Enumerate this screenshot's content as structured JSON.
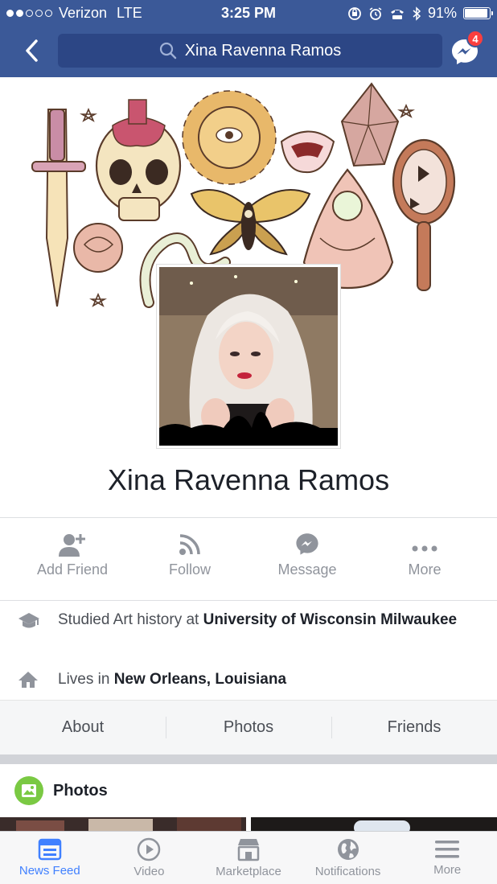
{
  "status_bar": {
    "carrier": "Verizon",
    "network": "LTE",
    "time": "3:25 PM",
    "battery": "91%"
  },
  "nav": {
    "search_text": "Xina Ravenna Ramos",
    "messenger_badge": "4"
  },
  "profile": {
    "name": "Xina Ravenna Ramos"
  },
  "actions": [
    {
      "label": "Add Friend",
      "icon": "add-friend-icon"
    },
    {
      "label": "Follow",
      "icon": "rss-icon"
    },
    {
      "label": "Message",
      "icon": "messenger-icon"
    },
    {
      "label": "More",
      "icon": "more-dots-icon"
    }
  ],
  "info": {
    "education_prefix": "Studied Art history at ",
    "education_school": "University of Wisconsin Milwaukee",
    "lives_prefix": "Lives in ",
    "lives_city": "New Orleans, Louisiana"
  },
  "subnav": [
    "About",
    "Photos",
    "Friends"
  ],
  "photos_section": {
    "title": "Photos"
  },
  "tabbar": [
    {
      "label": "News Feed",
      "icon": "news-feed-icon",
      "active": true
    },
    {
      "label": "Video",
      "icon": "video-icon"
    },
    {
      "label": "Marketplace",
      "icon": "marketplace-icon"
    },
    {
      "label": "Notifications",
      "icon": "globe-icon"
    },
    {
      "label": "More",
      "icon": "menu-icon"
    }
  ],
  "colors": {
    "brand": "#3b5998",
    "active_tab": "#4080ff",
    "badge": "#fa3e3e",
    "photos_icon": "#7ac943"
  }
}
